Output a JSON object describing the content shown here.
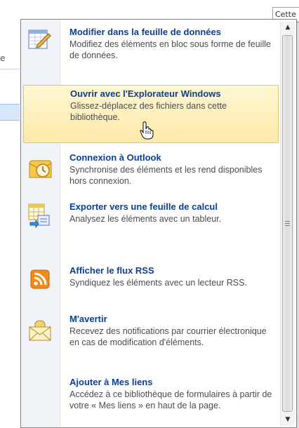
{
  "background": {
    "search_box_text": "Cette",
    "left_fragment": "e"
  },
  "menu": {
    "items": [
      {
        "title": "Modifier dans la feuille de données",
        "description": "Modifiez des éléments en bloc sous forme de feuille de données.",
        "icon": "datasheet-edit-icon"
      },
      {
        "title": "Ouvrir avec l'Explorateur Windows",
        "description": "Glissez-déplacez des fichiers dans cette bibliothèque.",
        "icon": "explorer-folder-icon",
        "hovered": true
      },
      {
        "title": "Connexion à Outlook",
        "description": "Synchronise des éléments et les rend disponibles hors connexion.",
        "icon": "outlook-clock-icon"
      },
      {
        "title": "Exporter vers une feuille de calcul",
        "description": "Analysez les éléments avec un tableur.",
        "icon": "spreadsheet-export-icon"
      },
      {
        "title": "Afficher le flux RSS",
        "description": "Syndiquez les éléments avec un lecteur RSS.",
        "icon": "rss-feed-icon"
      },
      {
        "title": "M'avertir",
        "description": "Recevez des notifications par courrier électronique en cas de modification d'éléments.",
        "icon": "alert-envelope-icon"
      },
      {
        "title": "Ajouter à Mes liens",
        "description": "Accédez à ce bibliothèque de formulaires à partir de votre « Mes liens » en haut de la page.",
        "icon": "my-links-icon"
      }
    ]
  },
  "colors": {
    "title_blue": "#0b3f91",
    "hover_fill": "#fde9a8",
    "rss_orange": "#f08a1c"
  }
}
